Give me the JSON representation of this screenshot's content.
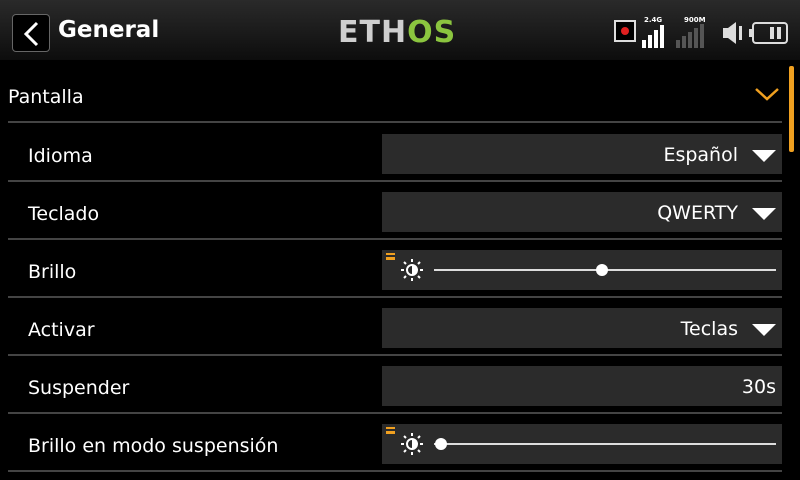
{
  "header": {
    "title": "General",
    "logo": {
      "part1": "ETH",
      "part2": "OS"
    },
    "signal_1_label": "2.4G",
    "signal_2_label": "900M"
  },
  "section": {
    "title": "Pantalla",
    "expanded": true
  },
  "rows": [
    {
      "label": "Idioma",
      "type": "dropdown",
      "value": "Español"
    },
    {
      "label": "Teclado",
      "type": "dropdown",
      "value": "QWERTY"
    },
    {
      "label": "Brillo",
      "type": "slider",
      "level": 0.49
    },
    {
      "label": "Activar",
      "type": "dropdown",
      "value": "Teclas"
    },
    {
      "label": "Suspender",
      "type": "number",
      "value": "30s"
    },
    {
      "label": "Brillo en modo suspensión",
      "type": "slider",
      "level": 0.02
    }
  ],
  "colors": {
    "accent": "#f0a020",
    "logo_green": "#8bc53f",
    "record_red": "#e02020",
    "field_bg": "#2b2b2b"
  }
}
